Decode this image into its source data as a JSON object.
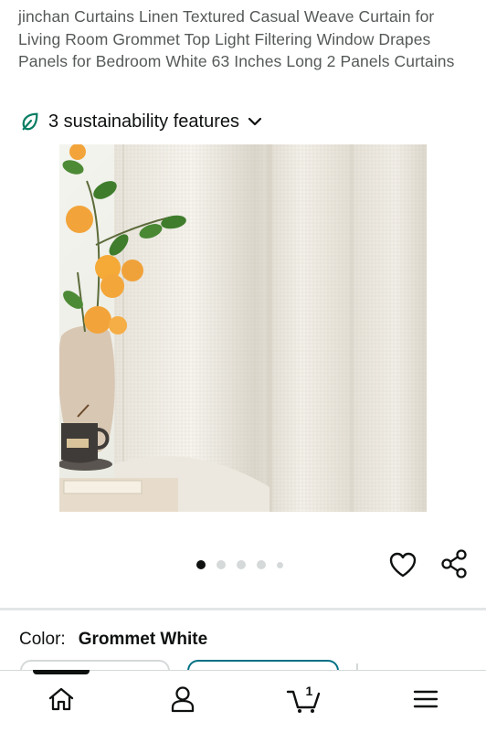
{
  "product": {
    "title": "jinchan Curtains Linen Textured Casual Weave Curtain for Living Room Grommet Top Light Filtering Window Drapes Panels for Bedroom White 63 Inches Long 2 Panels Curtains",
    "sustainability_label": "3 sustainability features",
    "image_count": 5,
    "active_image_index": 0,
    "color_label": "Color:",
    "color_value": "Grommet White"
  },
  "icons": {
    "sustainability": "leaf-icon",
    "expand": "chevron-down-icon",
    "favorite": "heart-icon",
    "share": "share-icon"
  },
  "bottom_nav": {
    "items": [
      {
        "name": "home",
        "icon": "home-icon"
      },
      {
        "name": "account",
        "icon": "person-icon"
      },
      {
        "name": "cart",
        "icon": "cart-icon",
        "count": "1"
      },
      {
        "name": "menu",
        "icon": "hamburger-menu-icon"
      }
    ]
  },
  "colors": {
    "accent_teal": "#007185",
    "leaf_green": "#067d62",
    "text_primary": "#0f1111",
    "text_secondary": "#565959"
  }
}
